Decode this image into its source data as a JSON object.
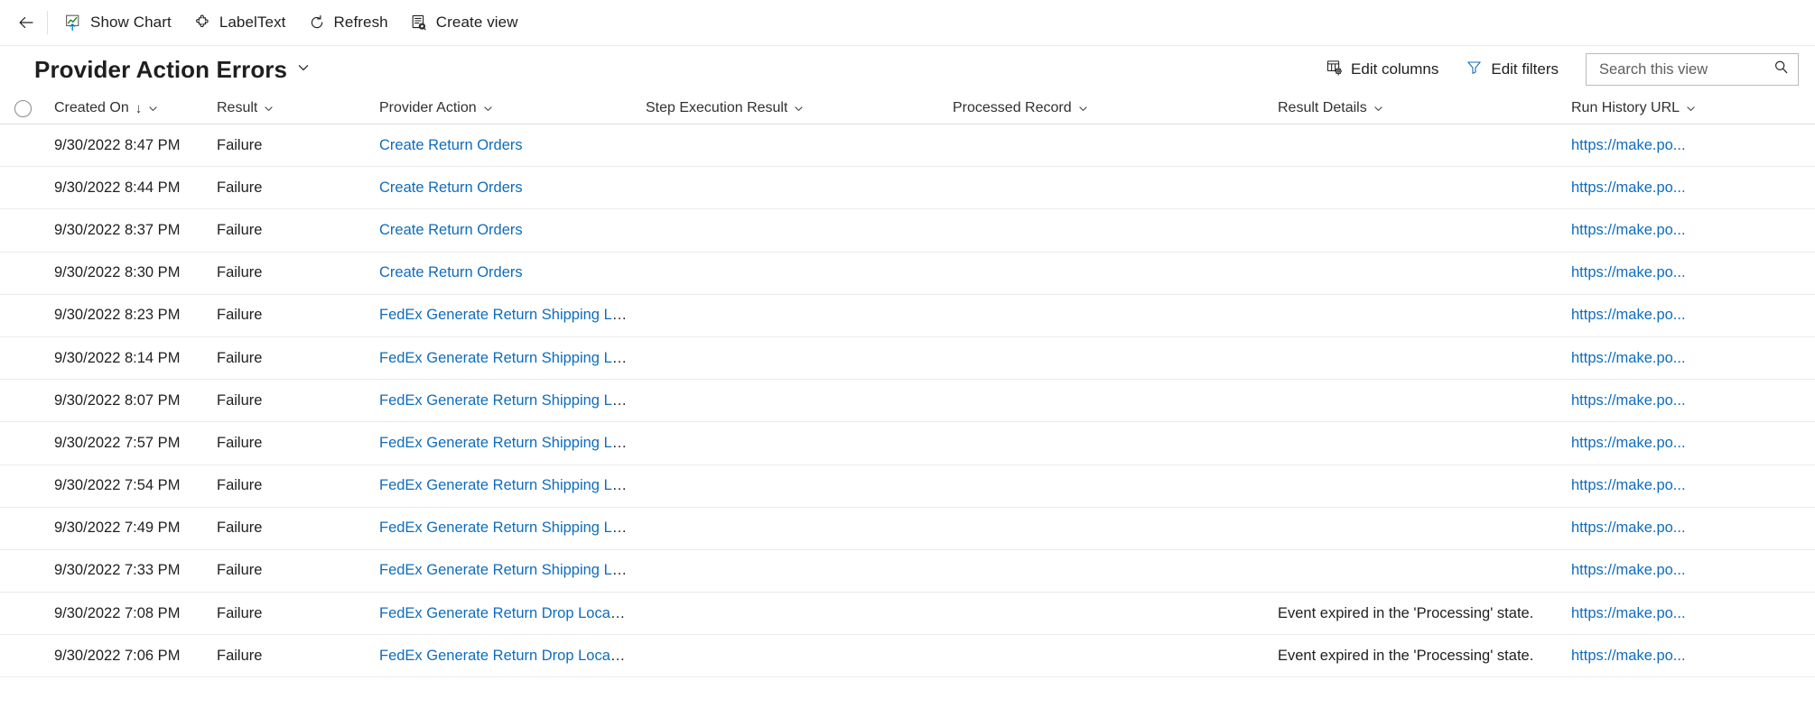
{
  "command_bar": {
    "back_icon": "arrow-left-icon",
    "buttons": [
      {
        "label": "Show Chart",
        "icon": "show-chart-icon"
      },
      {
        "label": "LabelText",
        "icon": "puzzle-piece-icon"
      },
      {
        "label": "Refresh",
        "icon": "refresh-icon"
      },
      {
        "label": "Create view",
        "icon": "create-view-icon"
      }
    ]
  },
  "view_header": {
    "title": "Provider Action Errors",
    "title_chevron_icon": "chevron-down-icon",
    "edit_columns": {
      "label": "Edit columns",
      "icon": "edit-columns-icon"
    },
    "edit_filters": {
      "label": "Edit filters",
      "icon": "filter-icon"
    },
    "search": {
      "placeholder": "Search this view",
      "value": "",
      "icon": "search-icon"
    }
  },
  "grid": {
    "select_all": {
      "name": "select-all-circle",
      "checked": false
    },
    "columns": [
      {
        "key": "created_on",
        "label": "Created On",
        "sorted": true,
        "sort_dir": "asc"
      },
      {
        "key": "result",
        "label": "Result",
        "sorted": false
      },
      {
        "key": "provider",
        "label": "Provider Action",
        "sorted": false
      },
      {
        "key": "step",
        "label": "Step Execution Result",
        "sorted": false
      },
      {
        "key": "processed",
        "label": "Processed Record",
        "sorted": false
      },
      {
        "key": "details",
        "label": "Result Details",
        "sorted": false
      },
      {
        "key": "url",
        "label": "Run History URL",
        "sorted": false
      }
    ],
    "sort_arrow_glyph": "↓",
    "rows": [
      {
        "created_on": "9/30/2022 8:47 PM",
        "result": "Failure",
        "provider": "Create Return Orders",
        "step": "",
        "processed": "",
        "details": "",
        "url": "https://make.po..."
      },
      {
        "created_on": "9/30/2022 8:44 PM",
        "result": "Failure",
        "provider": "Create Return Orders",
        "step": "",
        "processed": "",
        "details": "",
        "url": "https://make.po..."
      },
      {
        "created_on": "9/30/2022 8:37 PM",
        "result": "Failure",
        "provider": "Create Return Orders",
        "step": "",
        "processed": "",
        "details": "",
        "url": "https://make.po..."
      },
      {
        "created_on": "9/30/2022 8:30 PM",
        "result": "Failure",
        "provider": "Create Return Orders",
        "step": "",
        "processed": "",
        "details": "",
        "url": "https://make.po..."
      },
      {
        "created_on": "9/30/2022 8:23 PM",
        "result": "Failure",
        "provider": "FedEx Generate Return Shipping La...",
        "step": "",
        "processed": "",
        "details": "",
        "url": "https://make.po..."
      },
      {
        "created_on": "9/30/2022 8:14 PM",
        "result": "Failure",
        "provider": "FedEx Generate Return Shipping La...",
        "step": "",
        "processed": "",
        "details": "",
        "url": "https://make.po..."
      },
      {
        "created_on": "9/30/2022 8:07 PM",
        "result": "Failure",
        "provider": "FedEx Generate Return Shipping La...",
        "step": "",
        "processed": "",
        "details": "",
        "url": "https://make.po..."
      },
      {
        "created_on": "9/30/2022 7:57 PM",
        "result": "Failure",
        "provider": "FedEx Generate Return Shipping La...",
        "step": "",
        "processed": "",
        "details": "",
        "url": "https://make.po..."
      },
      {
        "created_on": "9/30/2022 7:54 PM",
        "result": "Failure",
        "provider": "FedEx Generate Return Shipping La...",
        "step": "",
        "processed": "",
        "details": "",
        "url": "https://make.po..."
      },
      {
        "created_on": "9/30/2022 7:49 PM",
        "result": "Failure",
        "provider": "FedEx Generate Return Shipping La...",
        "step": "",
        "processed": "",
        "details": "",
        "url": "https://make.po..."
      },
      {
        "created_on": "9/30/2022 7:33 PM",
        "result": "Failure",
        "provider": "FedEx Generate Return Shipping La...",
        "step": "",
        "processed": "",
        "details": "",
        "url": "https://make.po..."
      },
      {
        "created_on": "9/30/2022 7:08 PM",
        "result": "Failure",
        "provider": "FedEx Generate Return Drop Locati...",
        "step": "",
        "processed": "",
        "details": "Event expired in the 'Processing' state.",
        "url": "https://make.po..."
      },
      {
        "created_on": "9/30/2022 7:06 PM",
        "result": "Failure",
        "provider": "FedEx Generate Return Drop Locati...",
        "step": "",
        "processed": "",
        "details": "Event expired in the 'Processing' state.",
        "url": "https://make.po..."
      }
    ]
  },
  "colors": {
    "link": "#0f6cbd",
    "text": "#201f1e",
    "border": "#edebe9",
    "accent_chart_green": "#107c10",
    "accent_chart_blue": "#0078d4"
  }
}
